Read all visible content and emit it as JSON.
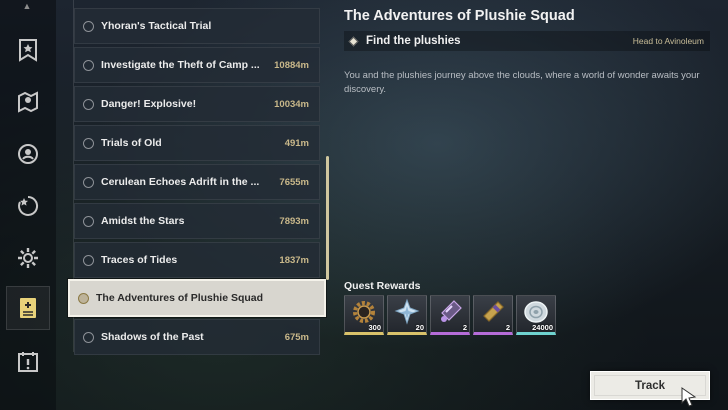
{
  "rail": {
    "items": [
      {
        "icon": "banner-quest-icon",
        "active": false
      },
      {
        "icon": "map-marker-icon",
        "active": false
      },
      {
        "icon": "compass-icon",
        "active": false
      },
      {
        "icon": "star-swirl-icon",
        "active": false
      },
      {
        "icon": "gear-icon",
        "active": false
      },
      {
        "icon": "quest-book-icon",
        "active": true
      },
      {
        "icon": "calendar-alert-icon",
        "active": false
      }
    ]
  },
  "quests": [
    {
      "name": "Yhoran's Tactical Trial",
      "distance": ""
    },
    {
      "name": "Investigate the Theft of Camp ...",
      "distance": "10884m"
    },
    {
      "name": "Danger! Explosive!",
      "distance": "10034m"
    },
    {
      "name": "Trials of Old",
      "distance": "491m"
    },
    {
      "name": "Cerulean Echoes Adrift in the ...",
      "distance": "7655m"
    },
    {
      "name": "Amidst the Stars",
      "distance": "7893m"
    },
    {
      "name": "Traces of Tides",
      "distance": "1837m"
    },
    {
      "name": "The Adventures of Plushie Squad",
      "distance": "",
      "selected": true
    },
    {
      "name": "Shadows of the Past",
      "distance": "675m"
    }
  ],
  "detail": {
    "title": "The Adventures of Plushie Squad",
    "objective": "Find the plushies",
    "objective_hint": "Head to Avinoleum",
    "description": "You and the plushies journey above the clouds, where a world of wonder awaits your discovery.",
    "rewards_title": "Quest Rewards",
    "rewards": [
      {
        "icon": "gear-ring-icon",
        "quantity": "300",
        "rarity_color": "#d9c26a"
      },
      {
        "icon": "crystal-star-icon",
        "quantity": "20",
        "rarity_color": "#d9c26a"
      },
      {
        "icon": "vial-icon",
        "quantity": "2",
        "rarity_color": "#b56cd8"
      },
      {
        "icon": "capsule-icon",
        "quantity": "2",
        "rarity_color": "#b56cd8"
      },
      {
        "icon": "shell-coin-icon",
        "quantity": "24000",
        "rarity_color": "#6fd3d0"
      }
    ]
  },
  "track_button": {
    "label": "Track"
  },
  "colors": {
    "distance": "#c9b88a",
    "selected_bg": "#d8d6cf",
    "scrollbar": "#cfc79f",
    "accent_gold": "#d9c26a"
  }
}
